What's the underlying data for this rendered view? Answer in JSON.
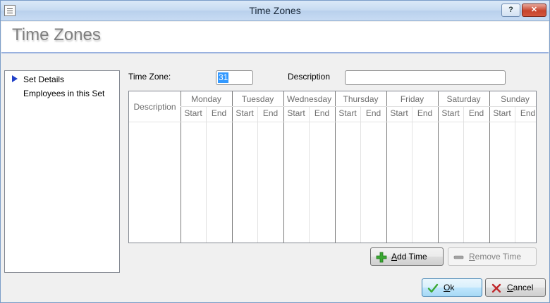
{
  "window": {
    "title": "Time Zones",
    "help_label": "?",
    "close_label": "✕"
  },
  "header": {
    "title": "Time Zones"
  },
  "nav": {
    "items": [
      {
        "label": "Set Details",
        "selected": true
      },
      {
        "label": "Employees in this Set",
        "selected": false
      }
    ]
  },
  "form": {
    "time_zone_label": "Time Zone:",
    "time_zone_value": "31",
    "description_label": "Description",
    "description_value": ""
  },
  "grid": {
    "description_header": "Description",
    "days": [
      "Monday",
      "Tuesday",
      "Wednesday",
      "Thursday",
      "Friday",
      "Saturday",
      "Sunday"
    ],
    "start_label": "Start",
    "end_label": "End",
    "rows": []
  },
  "actions": {
    "add_time": {
      "label": "Add Time",
      "mnemonic": "A",
      "rest": "dd Time",
      "enabled": true,
      "icon": "plus-icon"
    },
    "remove_time": {
      "label": "Remove Time",
      "mnemonic": "R",
      "rest": "emove Time",
      "enabled": false,
      "icon": "minus-icon"
    }
  },
  "dialog_buttons": {
    "ok": {
      "label": "Ok",
      "mnemonic": "O",
      "rest": "k",
      "icon": "check-icon"
    },
    "cancel": {
      "label": "Cancel",
      "mnemonic": "C",
      "rest": "ancel",
      "icon": "x-icon"
    }
  },
  "colors": {
    "accent": "#2241c9",
    "selection": "#3399ff",
    "add_icon": "#3aa832",
    "ok_icon": "#3aa832",
    "cancel_icon": "#c0282b"
  }
}
